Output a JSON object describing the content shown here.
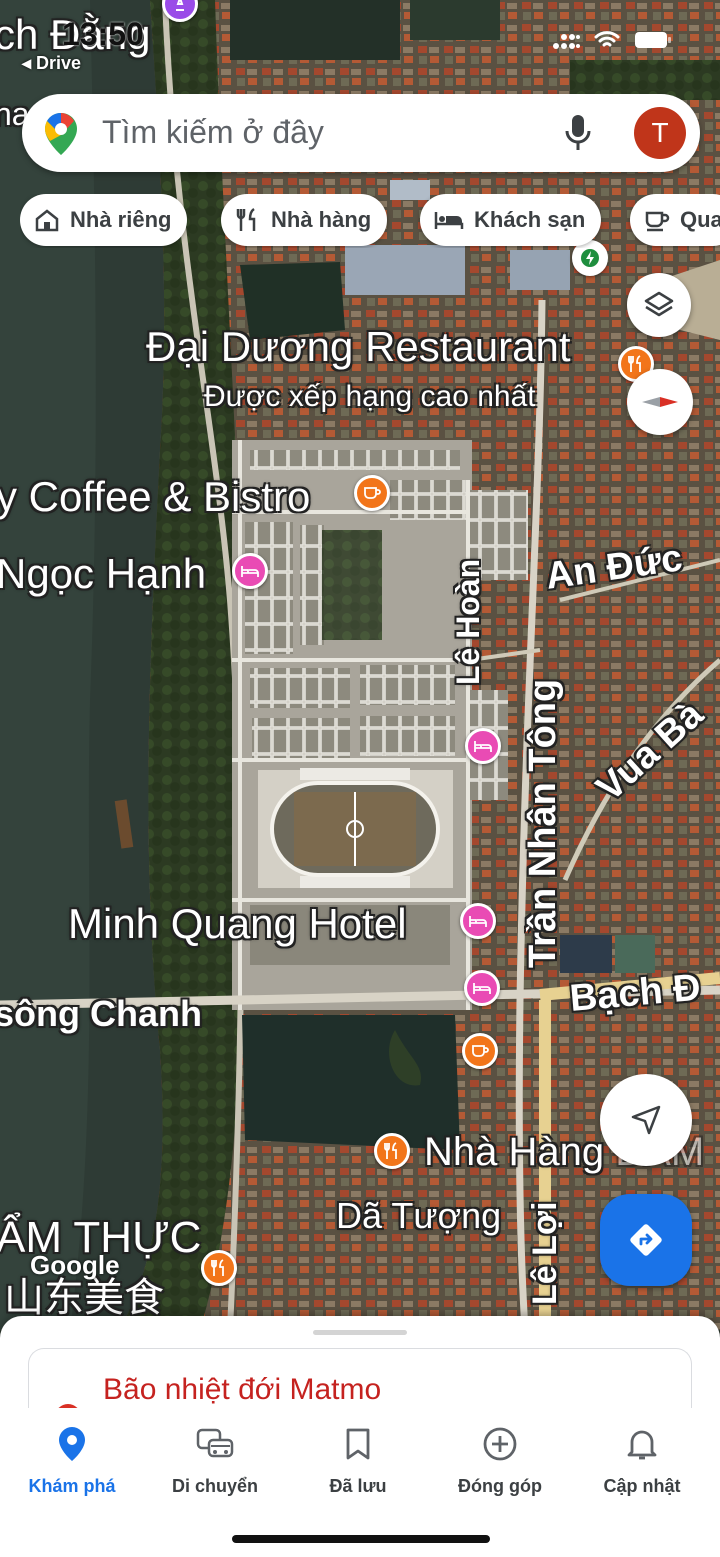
{
  "status_bar": {
    "time": "13:50",
    "back_label": "◂ Drive"
  },
  "search": {
    "placeholder": "Tìm kiếm ở đây",
    "avatar_letter": "T"
  },
  "chips": [
    {
      "label": "Nhà riêng",
      "icon": "home-icon"
    },
    {
      "label": "Nhà hàng",
      "icon": "restaurant-icon"
    },
    {
      "label": "Khách sạn",
      "icon": "hotel-icon"
    },
    {
      "label": "Qua",
      "icon": "coffee-icon"
    }
  ],
  "map": {
    "labels": {
      "top_left": "ch Đằng",
      "top_left_side": "na",
      "dai_duong": "Đại Dương Restaurant",
      "dai_duong_sub": "Được xếp hạng cao nhất",
      "coffee": "y Coffee & Bistro",
      "ngoc_hanh": "Ngọc Hạnh",
      "an_duc": "An Đức",
      "le_hoan": "Lê Hoàn",
      "tran_nhan_tong": "Trần Nhân Tông",
      "vua_ba": "Vua Bà",
      "minh_quang": "Minh Quang Hotel",
      "song_chanh": "sông Chanh",
      "bach_dang": "Bạch Đ",
      "nha_hang": "Nhà Hàng",
      "nha_hang_tail": "ĐAM",
      "da_tuong": "Dã Tượng",
      "le_loi": "Lê Lợi",
      "am_thuc": "ẨM THỰC",
      "chinese": "山东美食",
      "google": "Google"
    }
  },
  "sheet": {
    "alert_title": "Bão nhiệt đới Matmo"
  },
  "nav": [
    {
      "label": "Khám phá",
      "icon": "explore-pin-icon",
      "active": true
    },
    {
      "label": "Di chuyển",
      "icon": "commute-icon",
      "active": false
    },
    {
      "label": "Đã lưu",
      "icon": "bookmark-icon",
      "active": false
    },
    {
      "label": "Đóng góp",
      "icon": "add-circle-icon",
      "active": false
    },
    {
      "label": "Cập nhật",
      "icon": "bell-icon",
      "active": false
    }
  ],
  "colors": {
    "accent": "#1a73e8",
    "food_pin": "#f2751a",
    "hotel_pin": "#e94bb4",
    "alert": "#c5221f",
    "avatar": "#c0351a"
  }
}
